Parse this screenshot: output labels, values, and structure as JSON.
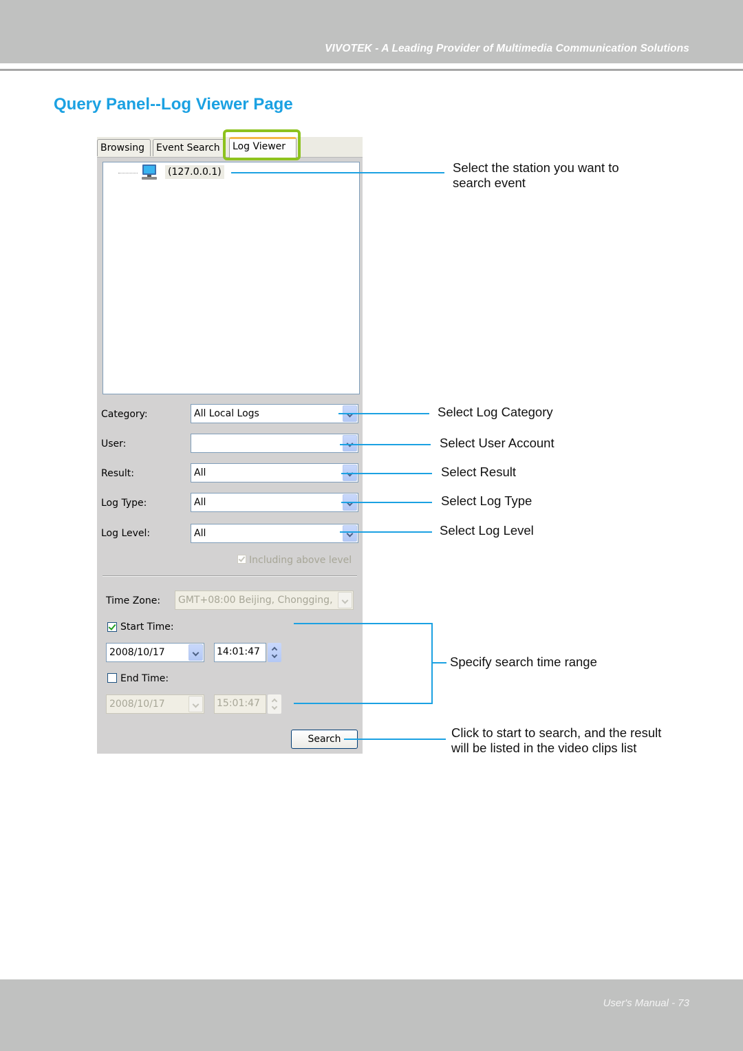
{
  "header": {
    "tagline": "VIVOTEK - A Leading Provider of Multimedia Communication Solutions"
  },
  "page_title": "Query Panel--Log Viewer Page",
  "panel": {
    "tabs": [
      {
        "label": "Browsing",
        "active": false
      },
      {
        "label": "Event Search",
        "active": false
      },
      {
        "label": "Log Viewer",
        "active": true
      }
    ],
    "tree": {
      "station_label": "(127.0.0.1)",
      "station_icon": "computer-icon"
    },
    "fields": {
      "category": {
        "label": "Category:",
        "value": "All Local Logs"
      },
      "user": {
        "label": "User:",
        "value": ""
      },
      "result": {
        "label": "Result:",
        "value": "All"
      },
      "log_type": {
        "label": "Log Type:",
        "value": "All"
      },
      "log_level": {
        "label": "Log Level:",
        "value": "All"
      }
    },
    "including_above_level": {
      "label": "Including above level",
      "checked": true,
      "disabled": true
    },
    "time_zone": {
      "label": "Time Zone:",
      "value": "GMT+08:00 Beijing, Chongging,",
      "disabled": true
    },
    "start_time": {
      "label": "Start Time:",
      "checked": true,
      "date": "2008/10/17",
      "time": "14:01:47"
    },
    "end_time": {
      "label": "End Time:",
      "checked": false,
      "date": "2008/10/17",
      "time": "15:01:47"
    },
    "search_button": "Search"
  },
  "annotations": {
    "station": "Select the station you want to search event",
    "station_line1": "Select the station you want to",
    "station_line2": "search event",
    "category": "Select Log Category",
    "user": "Select User Account",
    "result": "Select Result",
    "log_type": "Select Log Type",
    "log_level": "Select Log Level",
    "time_range": "Specify search time range",
    "search_line1": "Click to start to search, and the result",
    "search_line2": "will be listed in the video clips list"
  },
  "colors": {
    "accent_blue": "#1ba1e2",
    "highlight_green": "#8dc21f",
    "band_gray": "#c0c1c0"
  },
  "footer": {
    "page_label": "User's Manual - 73"
  }
}
